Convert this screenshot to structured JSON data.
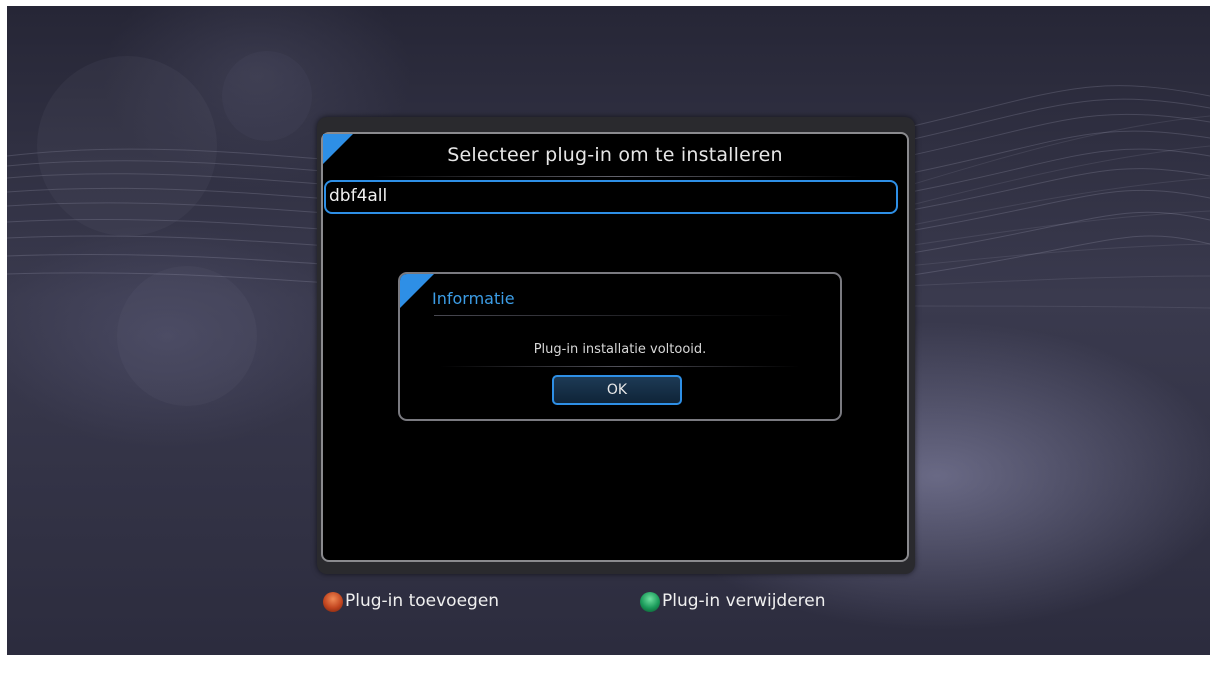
{
  "main_dialog": {
    "title": "Selecteer plug-in om te installeren",
    "selected_item": "dbf4all"
  },
  "info_dialog": {
    "title": "Informatie",
    "message": "Plug-in installatie voltooid.",
    "ok_label": "OK"
  },
  "footer": {
    "red": {
      "label": "Plug-in toevoegen",
      "icon": "red-button-icon",
      "color": "#c2451f"
    },
    "green": {
      "label": "Plug-in verwijderen",
      "icon": "green-button-icon",
      "color": "#1a9a5a"
    }
  },
  "colors": {
    "accent": "#2e8fe6",
    "info_title": "#3c9de6"
  }
}
